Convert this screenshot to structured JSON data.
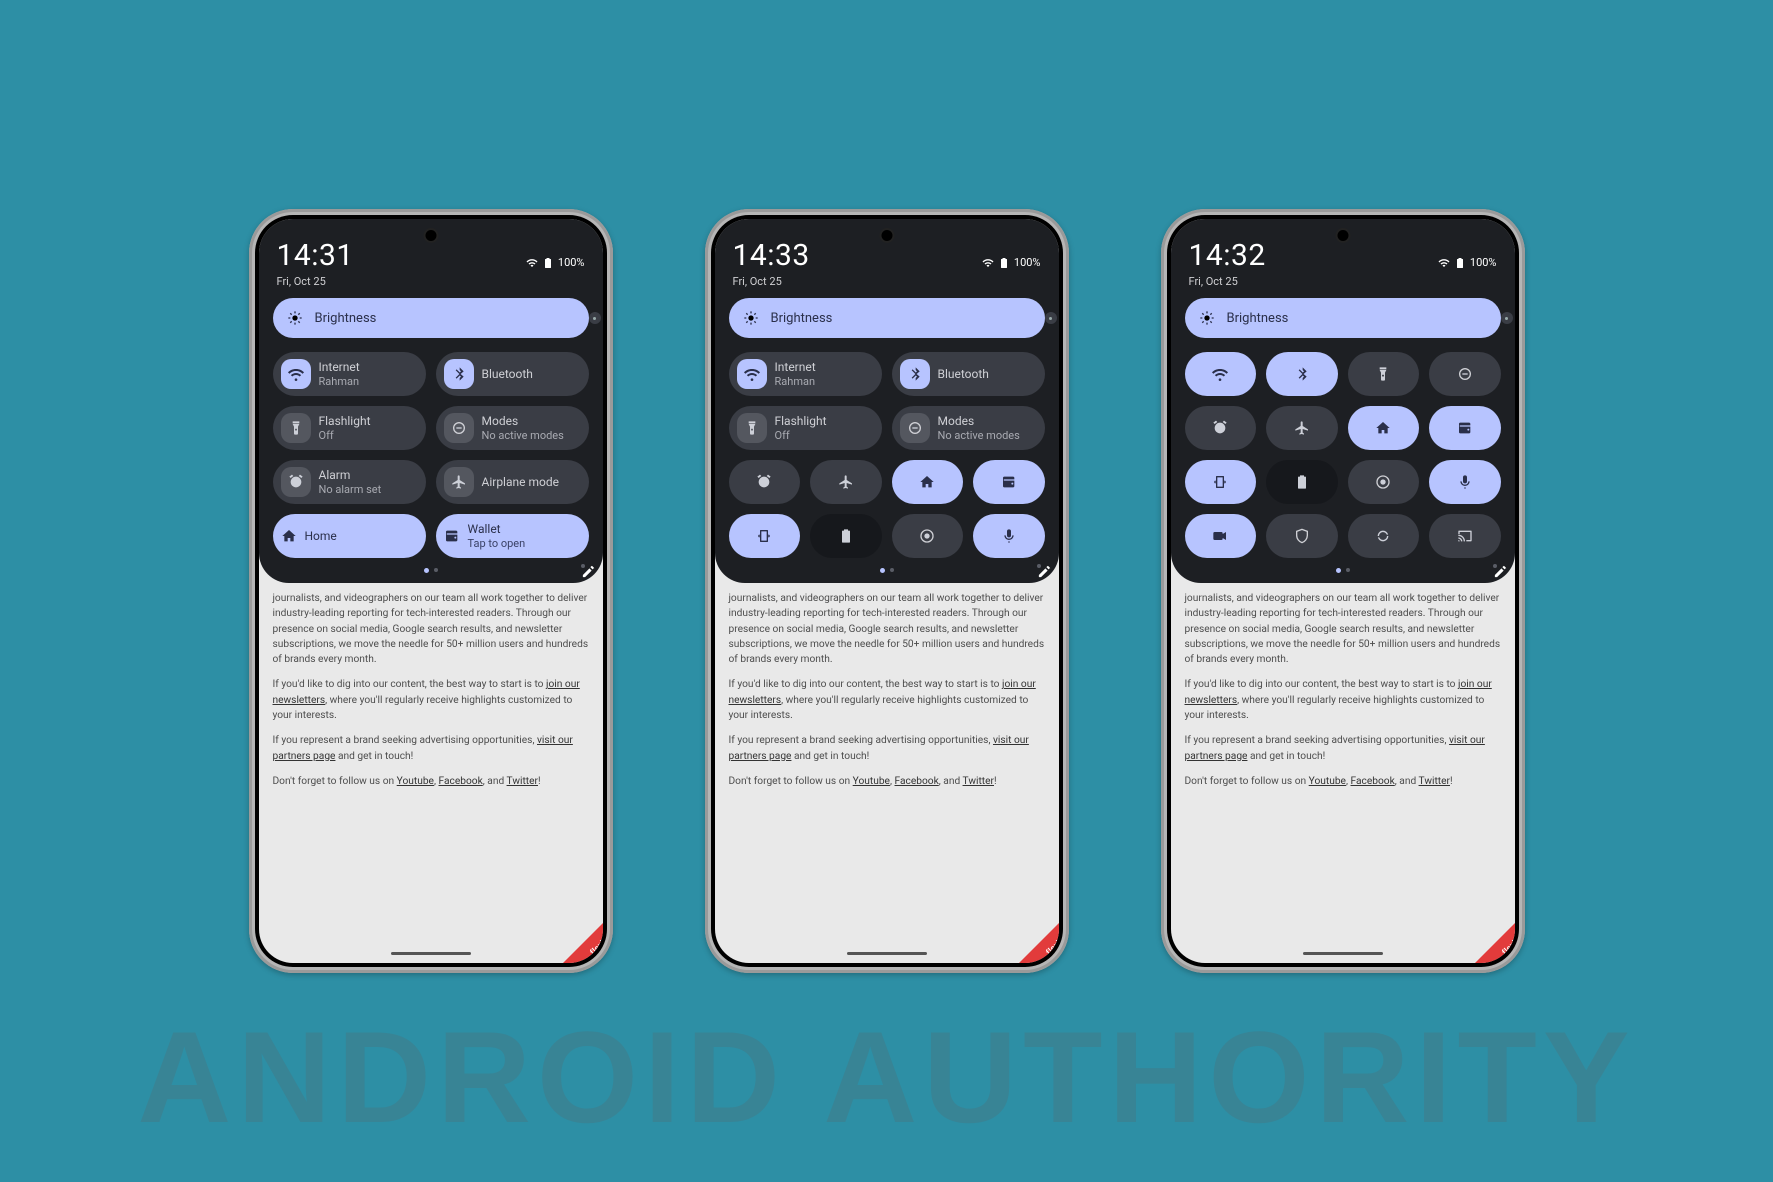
{
  "watermark": "ANDROID AUTHORITY",
  "battery_text": "100%",
  "brightness_label": "Brightness",
  "article": {
    "p1a": "journalists, and videographers on our team all work together to deliver industry-leading reporting for tech-interested readers. Through our presence on social media, Google search results, and newsletter subscriptions, we move the needle for 50+ million users and hundreds of brands every month.",
    "p2a": "If you'd like to dig into our content, the best way to start is to ",
    "p2link": "join our newsletters",
    "p2b": ", where you'll regularly receive highlights customized to your interests.",
    "p3a": "If you represent a brand seeking advertising opportunities, ",
    "p3link": "visit our partners page",
    "p3b": " and get in touch!",
    "p4a": "Don't forget to follow us on ",
    "yt": "Youtube",
    "fb": "Facebook",
    "tw": "Twitter",
    "sep": ", ",
    "and": ", and ",
    "bang": "!"
  },
  "phones": [
    {
      "time": "14:31",
      "date": "Fri, Oct 25",
      "layout": "2col-labeled",
      "tiles": [
        {
          "icon": "wifi",
          "t1": "Internet",
          "t2": "Rahman",
          "state": "chip-on"
        },
        {
          "icon": "bluetooth",
          "t1": "Bluetooth",
          "t2": "",
          "state": "chip-on"
        },
        {
          "icon": "flashlight",
          "t1": "Flashlight",
          "t2": "Off",
          "state": "chip-off"
        },
        {
          "icon": "modes",
          "t1": "Modes",
          "t2": "No active modes",
          "state": "chip-off"
        },
        {
          "icon": "alarm",
          "t1": "Alarm",
          "t2": "No alarm set",
          "state": "chip-off"
        },
        {
          "icon": "airplane",
          "t1": "Airplane mode",
          "t2": "",
          "state": "chip-off"
        },
        {
          "icon": "home",
          "t1": "Home",
          "t2": "",
          "state": "full-on"
        },
        {
          "icon": "wallet",
          "t1": "Wallet",
          "t2": "Tap to open",
          "state": "full-on"
        }
      ]
    },
    {
      "time": "14:33",
      "date": "Fri, Oct 25",
      "layout": "mixed",
      "labeled": [
        {
          "icon": "wifi",
          "t1": "Internet",
          "t2": "Rahman",
          "state": "chip-on"
        },
        {
          "icon": "bluetooth",
          "t1": "Bluetooth",
          "t2": "",
          "state": "chip-on"
        },
        {
          "icon": "flashlight",
          "t1": "Flashlight",
          "t2": "Off",
          "state": "chip-off"
        },
        {
          "icon": "modes",
          "t1": "Modes",
          "t2": "No active modes",
          "state": "chip-off"
        }
      ],
      "small": [
        {
          "icon": "alarm",
          "state": "off"
        },
        {
          "icon": "airplane",
          "state": "off"
        },
        {
          "icon": "home",
          "state": "on"
        },
        {
          "icon": "wallet",
          "state": "on"
        },
        {
          "icon": "rotate",
          "state": "on"
        },
        {
          "icon": "battery",
          "state": "dark"
        },
        {
          "icon": "record",
          "state": "off"
        },
        {
          "icon": "mic",
          "state": "on"
        }
      ]
    },
    {
      "time": "14:32",
      "date": "Fri, Oct 25",
      "layout": "4col-icon",
      "small": [
        {
          "icon": "wifi",
          "state": "on"
        },
        {
          "icon": "bluetooth",
          "state": "on"
        },
        {
          "icon": "flashlight",
          "state": "off"
        },
        {
          "icon": "modes",
          "state": "off"
        },
        {
          "icon": "alarm",
          "state": "off"
        },
        {
          "icon": "airplane",
          "state": "off"
        },
        {
          "icon": "home",
          "state": "on"
        },
        {
          "icon": "wallet",
          "state": "on"
        },
        {
          "icon": "rotate",
          "state": "on"
        },
        {
          "icon": "battery",
          "state": "dark"
        },
        {
          "icon": "record",
          "state": "off"
        },
        {
          "icon": "mic",
          "state": "on"
        },
        {
          "icon": "camera",
          "state": "on"
        },
        {
          "icon": "shield",
          "state": "off"
        },
        {
          "icon": "sync",
          "state": "off"
        },
        {
          "icon": "cast",
          "state": "off"
        }
      ]
    }
  ]
}
